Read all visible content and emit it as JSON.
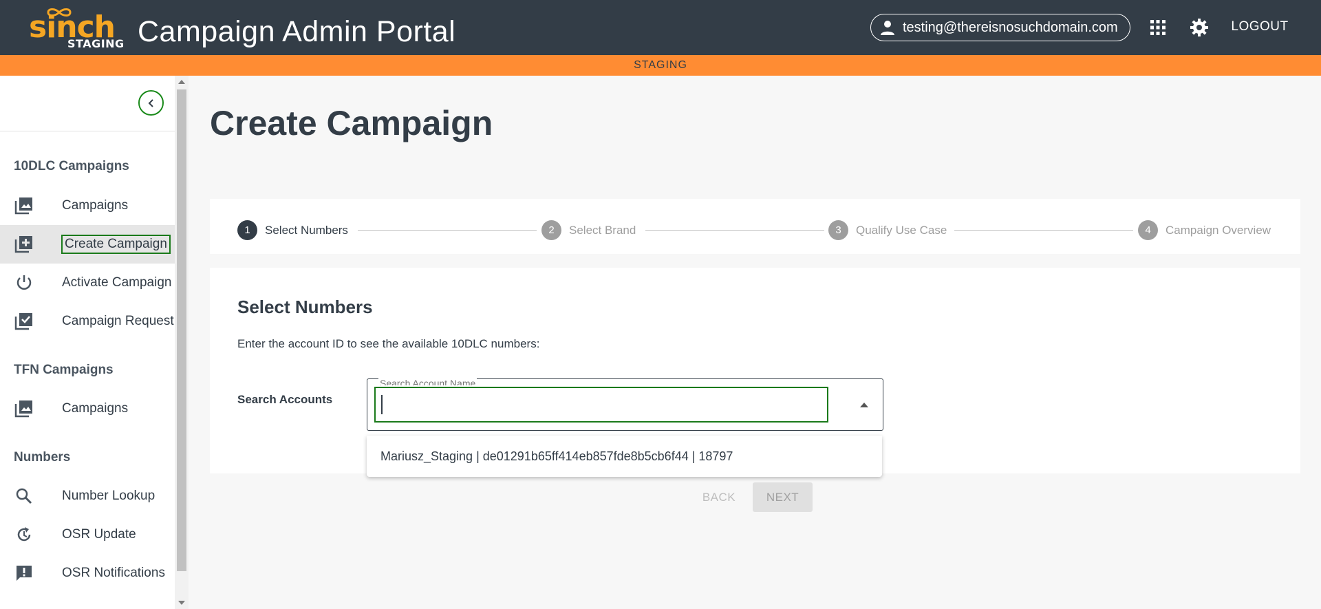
{
  "header": {
    "logo_text": "sinch",
    "logo_badge": "STAGING",
    "title": "Campaign Admin Portal",
    "user_email": "testing@thereisnosuchdomain.com",
    "apps_icon": "apps-grid-icon",
    "settings_icon": "gear-icon",
    "logout_label": "LOGOUT"
  },
  "env_banner": "STAGING",
  "sidebar": {
    "sections": [
      {
        "title": "10DLC Campaigns",
        "items": [
          {
            "label": "Campaigns",
            "icon": "image-gallery-icon"
          },
          {
            "label": "Create Campaign",
            "icon": "add-to-library-icon",
            "active": true
          },
          {
            "label": "Activate Campaign",
            "icon": "power-icon"
          },
          {
            "label": "Campaign Request",
            "icon": "library-check-icon"
          }
        ]
      },
      {
        "title": "TFN Campaigns",
        "items": [
          {
            "label": "Campaigns",
            "icon": "image-gallery-icon"
          }
        ]
      },
      {
        "title": "Numbers",
        "items": [
          {
            "label": "Number Lookup",
            "icon": "search-icon"
          },
          {
            "label": "OSR Update",
            "icon": "refresh-icon"
          },
          {
            "label": "OSR Notifications",
            "icon": "feedback-icon"
          }
        ]
      }
    ]
  },
  "main": {
    "page_title": "Create Campaign",
    "stepper": [
      {
        "num": "1",
        "label": "Select Numbers",
        "active": true
      },
      {
        "num": "2",
        "label": "Select Brand"
      },
      {
        "num": "3",
        "label": "Qualify Use Case"
      },
      {
        "num": "4",
        "label": "Campaign Overview"
      }
    ],
    "card": {
      "title": "Select Numbers",
      "description": "Enter the account ID to see the available 10DLC numbers:",
      "search_label": "Search Accounts",
      "search_field_label": "Search Account Name",
      "search_value": "",
      "dropdown_options": [
        "Mariusz_Staging | de01291b65ff414eb857fde8b5cb6f44 | 18797"
      ]
    },
    "back_label": "BACK",
    "next_label": "NEXT"
  },
  "colors": {
    "header_bg": "#333d47",
    "staging_bar": "#ff8c33",
    "logo_orange": "#f5a623",
    "focus_outline": "#1a7a1a"
  }
}
